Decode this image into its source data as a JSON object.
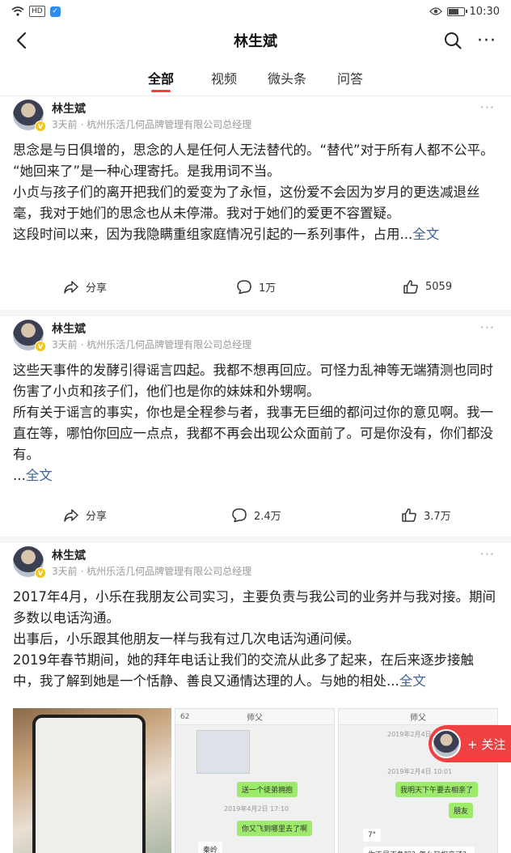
{
  "status_bar": {
    "time": "10:30",
    "network_badge": "HD",
    "battery_level": 0.6
  },
  "nav": {
    "title": "林生斌",
    "more": "···"
  },
  "tabs": [
    {
      "label": "全部",
      "active": true
    },
    {
      "label": "视频",
      "active": false
    },
    {
      "label": "微头条",
      "active": false
    },
    {
      "label": "问答",
      "active": false
    }
  ],
  "posts": [
    {
      "author": "林生斌",
      "meta": "3天前 · 杭州乐活几何品牌管理有限公司总经理",
      "more": "···",
      "paragraphs": [
        "思念是与日俱增的，思念的人是任何人无法替代的。“替代”对于所有人都不公平。",
        "“她回来了”是一种心理寄托。是我用词不当。",
        "小贞与孩子们的离开把我们的爱变为了永恒，这份爱不会因为岁月的更迭减退丝毫，我对于她们的思念也从未停滞。我对于她们的爱更不容置疑。",
        "这段时间以来，因为我隐瞒重组家庭情况引起的一系列事件，占用..."
      ],
      "full_text_link": "全文",
      "share": "分享",
      "comments": "1万",
      "likes": "5059"
    },
    {
      "author": "林生斌",
      "meta": "3天前 · 杭州乐活几何品牌管理有限公司总经理",
      "more": "···",
      "paragraphs": [
        "这些天事件的发酵引得谣言四起。我都不想再回应。可怪力乱神等无端猜测也同时伤害了小贞和孩子们，他们也是你的妹妹和外甥啊。",
        "所有关于谣言的事实，你也是全程参与者，我事无巨细的都问过你的意见啊。我一直在等，哪怕你回应一点点，我都不再会出现公众面前了。可是你没有，你们都没有。",
        "..."
      ],
      "full_text_link": "全文",
      "share": "分享",
      "comments": "2.4万",
      "likes": "3.7万"
    },
    {
      "author": "林生斌",
      "meta": "3天前 · 杭州乐活几何品牌管理有限公司总经理",
      "more": "···",
      "paragraphs": [
        "2017年4月，小乐在我朋友公司实习，主要负责与我公司的业务并与我对接。期间多数以电话沟通。",
        "出事后，小乐跟其他朋友一样与我有过几次电话沟通问候。",
        "2019年春节期间，她的拜年电话让我们的交流从此多了起来，在后来逐步接触中，我了解到她是一个恬静、善良又通情达理的人。与她的相处..."
      ],
      "full_text_link": "全文",
      "images": {
        "chat2_title": "师父",
        "chat2_back": "62",
        "chat2_msg1": "送一个徒弟拥抱",
        "chat2_time": "2019年4月2日 17:10",
        "chat2_msg2": "你又飞到哪里去了啊",
        "chat2_name": "秦岭",
        "chat3_title": "师父",
        "chat3_date": "2019年2月4日",
        "chat3_time": "2019年2月4日 10:01",
        "chat3_msg1": "我明天下午要去相亲了",
        "chat3_msg2": "朋友",
        "chat3_msg3": "7\"",
        "chat3_msg4": "你不是不急吗？怎么又相亲了？"
      }
    }
  ],
  "follow_button": {
    "label": "+ 关注"
  }
}
